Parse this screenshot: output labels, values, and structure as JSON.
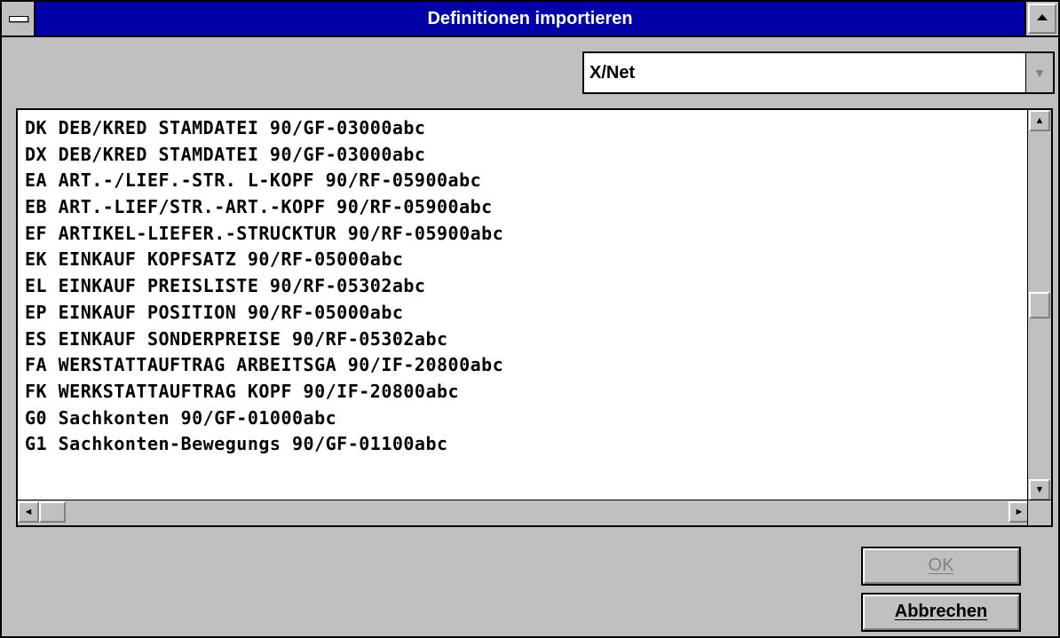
{
  "window": {
    "title": "Definitionen importieren"
  },
  "source_select": {
    "value": "X/Net"
  },
  "definitions": {
    "items": [
      "DK DEB/KRED STAMDATEI 90/GF-03000abc",
      "DX DEB/KRED STAMDATEI 90/GF-03000abc",
      "EA ART.-/LIEF.-STR. L-KOPF 90/RF-05900abc",
      "EB ART.-LIEF/STR.-ART.-KOPF 90/RF-05900abc",
      "EF ARTIKEL-LIEFER.-STRUCKTUR 90/RF-05900abc",
      "EK EINKAUF KOPFSATZ 90/RF-05000abc",
      "EL EINKAUF PREISLISTE 90/RF-05302abc",
      "EP EINKAUF POSITION 90/RF-05000abc",
      "ES EINKAUF SONDERPREISE 90/RF-05302abc",
      "FA WERSTATTAUFTRAG ARBEITSGA 90/IF-20800abc",
      "FK WERKSTATTAUFTRAG KOPF 90/IF-20800abc",
      "G0 Sachkonten 90/GF-01000abc",
      "G1 Sachkonten-Bewegungs 90/GF-01100abc"
    ]
  },
  "buttons": {
    "ok_label": "OK",
    "ok_enabled": false,
    "cancel_label": "Abbrechen"
  },
  "icons": {
    "system_menu": "system-menu-icon",
    "maximize": "maximize-icon",
    "dropdown": "dropdown-arrow-icon",
    "scroll_up": "arrow-up-icon",
    "scroll_down": "arrow-down-icon",
    "scroll_left": "arrow-left-icon",
    "scroll_right": "arrow-right-icon"
  },
  "scroll": {
    "vertical_position": 0.5,
    "horizontal_position": 0
  },
  "colors": {
    "titlebar": "#0000a8",
    "face": "#c0c0c0",
    "disabled_text": "#808080"
  }
}
